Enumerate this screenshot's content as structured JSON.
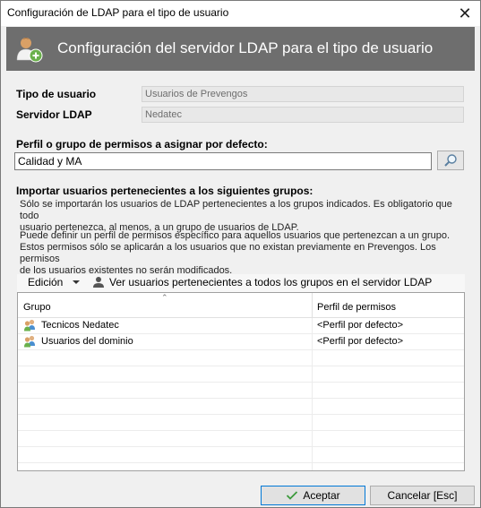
{
  "window": {
    "title": "Configuración de LDAP para el tipo de usuario",
    "close_glyph": "✕"
  },
  "banner": {
    "title": "Configuración del servidor LDAP para el tipo de usuario",
    "icon": "users-add-icon"
  },
  "form": {
    "user_type_label": "Tipo de usuario",
    "user_type_value": "Usuarios de Prevengos",
    "ldap_server_label": "Servidor LDAP",
    "ldap_server_value": "Nedatec",
    "profile_label": "Perfil o grupo de permisos a asignar por defecto:",
    "profile_value": "Calidad y MA",
    "import_label": "Importar usuarios pertenecientes a los siguientes grupos:",
    "info_1_line_1": "Sólo se importarán los usuarios de LDAP pertenecientes a los grupos indicados. Es obligatorio que todo",
    "info_1_line_2": "usuario pertenezca, al menos, a un grupo de usuarios de LDAP.",
    "info_2_line_1": "Puede definir un perfil de permisos específico para aquellos usuarios que pertenezcan a un grupo.",
    "info_2_line_2": "Estos permisos sólo se aplicarán a los usuarios que no existan previamente en Prevengos. Los permisos",
    "info_2_line_3": "de los usuarios existentes no serán modificados."
  },
  "toolbar": {
    "edit_label": "Edición",
    "view_users_label": "Ver usuarios pertenecientes a todos los grupos en el servidor LDAP"
  },
  "grid": {
    "col_group": "Grupo",
    "col_profile": "Perfil de permisos",
    "rows": [
      {
        "group": "Tecnicos Nedatec",
        "profile": "<Perfil por defecto>"
      },
      {
        "group": "Usuarios del dominio",
        "profile": "<Perfil por defecto>"
      }
    ]
  },
  "buttons": {
    "accept": "Aceptar",
    "cancel": "Cancelar [Esc]"
  },
  "colors": {
    "banner_bg": "#6e6e6e",
    "accent": "#0078d7",
    "check_green": "#3c9a3c"
  }
}
